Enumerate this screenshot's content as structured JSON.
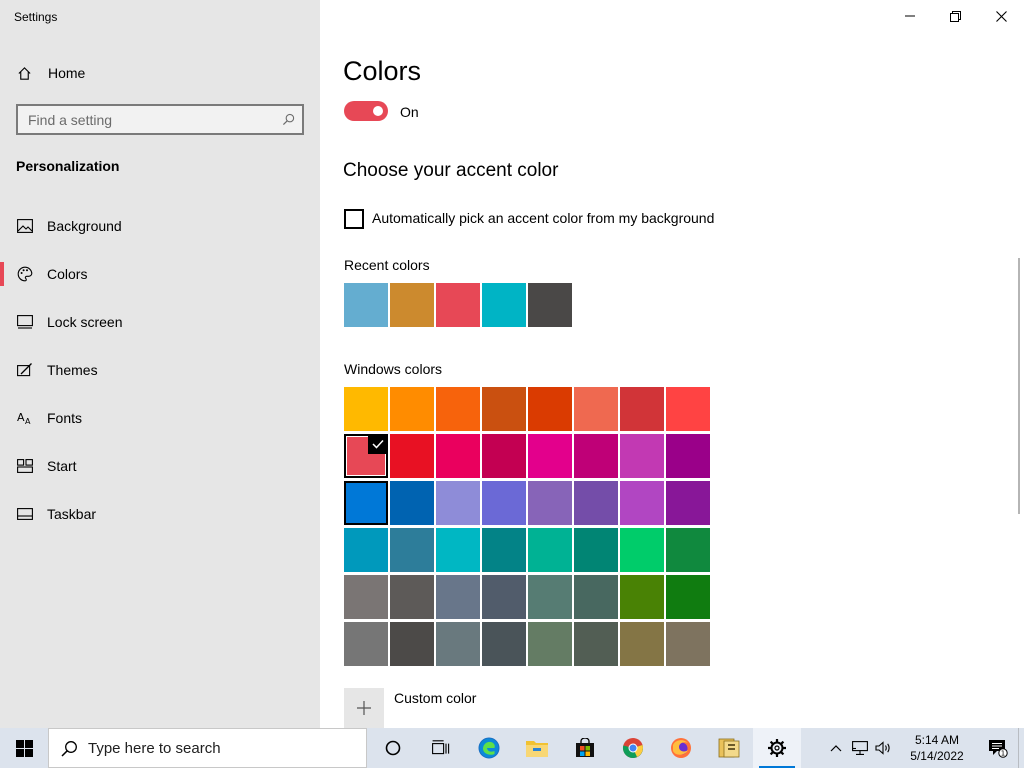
{
  "app_title": "Settings",
  "window_controls": {
    "minimize_icon": "minimize-icon",
    "restore_icon": "restore-icon",
    "close_icon": "close-icon"
  },
  "sidebar": {
    "home_label": "Home",
    "search_placeholder": "Find a setting",
    "section_header": "Personalization",
    "items": [
      {
        "label": "Background",
        "icon": "picture-icon"
      },
      {
        "label": "Colors",
        "icon": "palette-icon",
        "active": true
      },
      {
        "label": "Lock screen",
        "icon": "lock-screen-icon"
      },
      {
        "label": "Themes",
        "icon": "themes-icon"
      },
      {
        "label": "Fonts",
        "icon": "fonts-icon"
      },
      {
        "label": "Start",
        "icon": "start-icon"
      },
      {
        "label": "Taskbar",
        "icon": "taskbar-icon"
      }
    ]
  },
  "main": {
    "title": "Colors",
    "toggle_label": "On",
    "accent_title": "Choose your accent color",
    "auto_pick_label": "Automatically pick an accent color from my background",
    "recent_label": "Recent colors",
    "windows_label": "Windows colors",
    "custom_label": "Custom color"
  },
  "recent_colors": [
    "#64add0",
    "#cc8a2e",
    "#e74856",
    "#00b4c5",
    "#4a4847"
  ],
  "windows_colors": [
    [
      "#ffb900",
      "#ff8c00",
      "#f7630c",
      "#ca5010",
      "#da3b01",
      "#ef6950",
      "#d13438",
      "#ff4343"
    ],
    [
      "#e74856",
      "#e81123",
      "#ea005e",
      "#c30052",
      "#e3008c",
      "#bf0077",
      "#c239b3",
      "#9a0089"
    ],
    [
      "#0078d7",
      "#0063b1",
      "#8e8cd8",
      "#6b69d6",
      "#8764b8",
      "#744da9",
      "#b146c2",
      "#881798"
    ],
    [
      "#0099bc",
      "#2d7d9a",
      "#00b7c3",
      "#038387",
      "#00b294",
      "#018574",
      "#00cc6a",
      "#10893e"
    ],
    [
      "#7a7574",
      "#5d5a58",
      "#68768a",
      "#515c6b",
      "#567c73",
      "#486860",
      "#498205",
      "#107c10"
    ],
    [
      "#767676",
      "#4c4a48",
      "#69797e",
      "#4a5459",
      "#647c64",
      "#525e54",
      "#847545",
      "#7e735f"
    ]
  ],
  "selected_color": "#e74856",
  "taskbar": {
    "search_placeholder": "Type here to search",
    "apps": [
      "cortana-icon",
      "task-view-icon",
      "edge-icon",
      "file-explorer-icon",
      "store-icon",
      "chrome-icon",
      "firefox-icon",
      "archive-icon",
      "settings-icon"
    ],
    "time": "5:14 AM",
    "date": "5/14/2022",
    "notification_count": "1"
  },
  "colors": {
    "accent": "#e74856",
    "sidebar_bg": "#e6e6e6",
    "taskbar_bg": "#dce3ed"
  }
}
